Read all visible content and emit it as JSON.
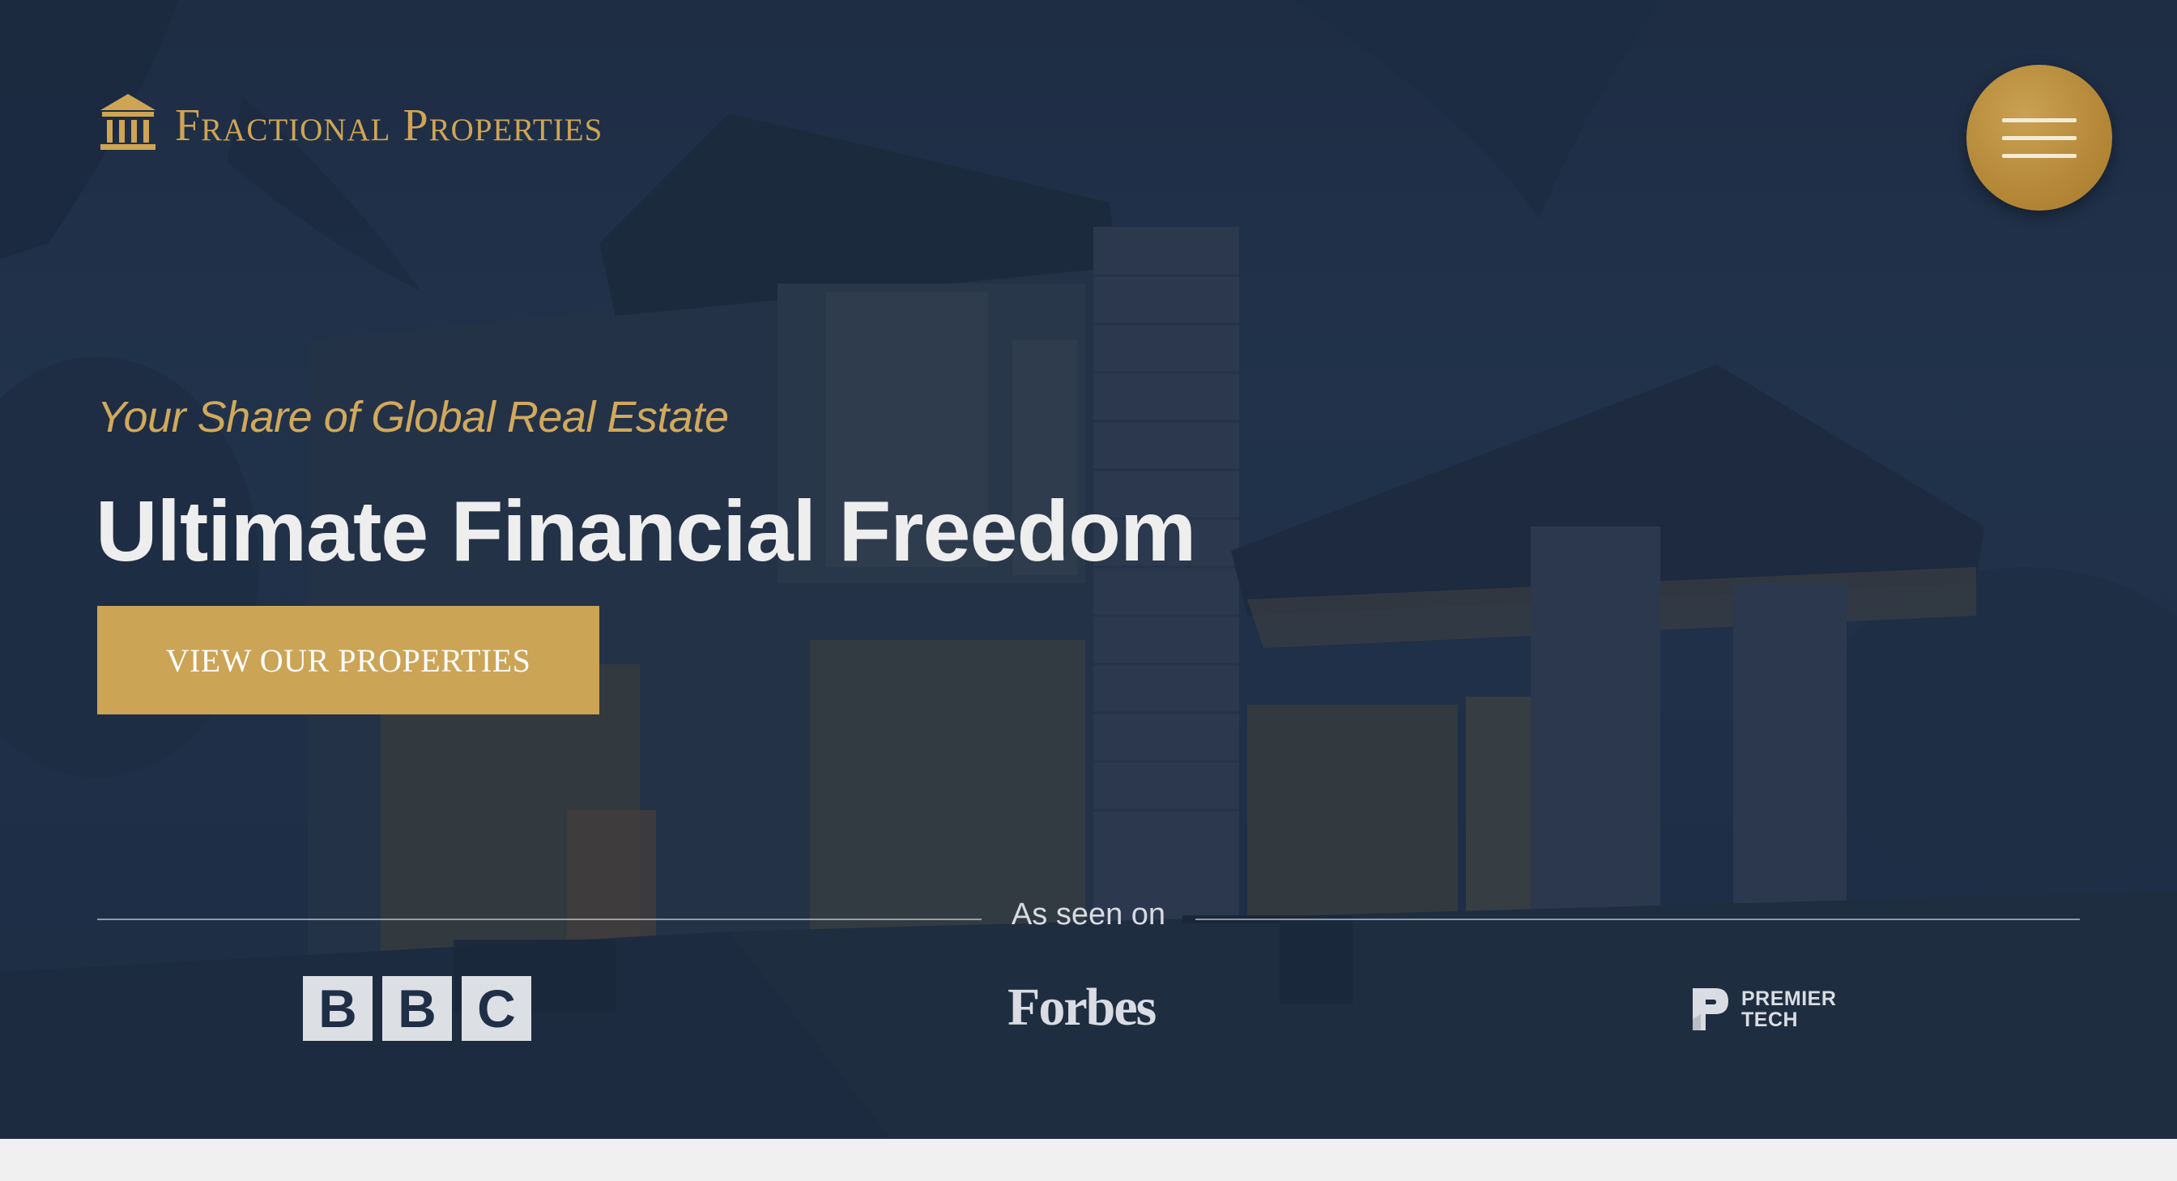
{
  "brand": {
    "name": "Fractional Properties",
    "icon": "columns-building-icon",
    "color": "#cfa554"
  },
  "header": {
    "menu_icon": "hamburger-menu-icon",
    "menu_button_color": "#b58838"
  },
  "hero": {
    "tagline": "Your Share of Global Real Estate",
    "headline": "Ultimate Financial Freedom",
    "cta_label": "VIEW OUR PROPERTIES",
    "cta_color": "#cca456",
    "overlay_color": "#1f2f47"
  },
  "press": {
    "label": "As seen on",
    "logos": {
      "bbc": [
        "B",
        "B",
        "C"
      ],
      "forbes": "Forbes",
      "premier_line1": "PREMIER",
      "premier_line2": "TECH"
    }
  }
}
